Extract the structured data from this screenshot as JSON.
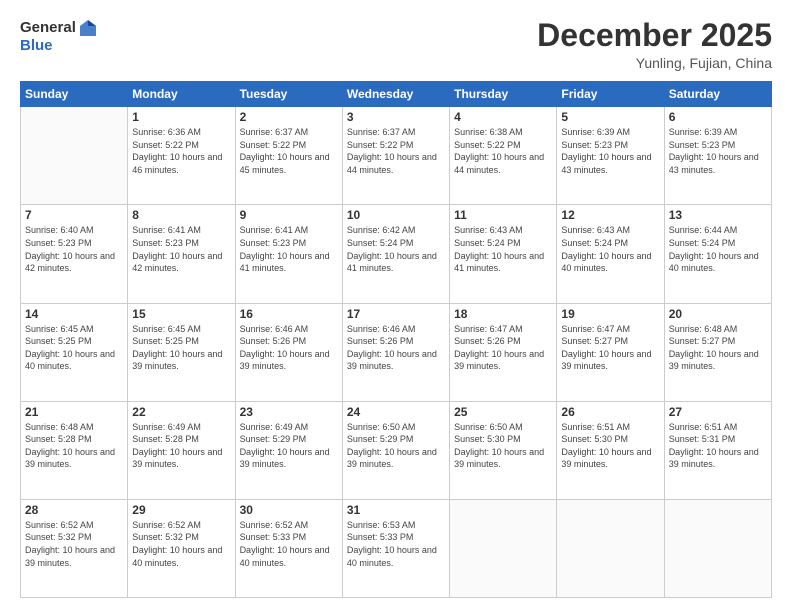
{
  "header": {
    "logo_general": "General",
    "logo_blue": "Blue",
    "month_title": "December 2025",
    "location": "Yunling, Fujian, China"
  },
  "weekdays": [
    "Sunday",
    "Monday",
    "Tuesday",
    "Wednesday",
    "Thursday",
    "Friday",
    "Saturday"
  ],
  "weeks": [
    [
      {
        "day": "",
        "sunrise": "",
        "sunset": "",
        "daylight": ""
      },
      {
        "day": "1",
        "sunrise": "Sunrise: 6:36 AM",
        "sunset": "Sunset: 5:22 PM",
        "daylight": "Daylight: 10 hours and 46 minutes."
      },
      {
        "day": "2",
        "sunrise": "Sunrise: 6:37 AM",
        "sunset": "Sunset: 5:22 PM",
        "daylight": "Daylight: 10 hours and 45 minutes."
      },
      {
        "day": "3",
        "sunrise": "Sunrise: 6:37 AM",
        "sunset": "Sunset: 5:22 PM",
        "daylight": "Daylight: 10 hours and 44 minutes."
      },
      {
        "day": "4",
        "sunrise": "Sunrise: 6:38 AM",
        "sunset": "Sunset: 5:22 PM",
        "daylight": "Daylight: 10 hours and 44 minutes."
      },
      {
        "day": "5",
        "sunrise": "Sunrise: 6:39 AM",
        "sunset": "Sunset: 5:23 PM",
        "daylight": "Daylight: 10 hours and 43 minutes."
      },
      {
        "day": "6",
        "sunrise": "Sunrise: 6:39 AM",
        "sunset": "Sunset: 5:23 PM",
        "daylight": "Daylight: 10 hours and 43 minutes."
      }
    ],
    [
      {
        "day": "7",
        "sunrise": "Sunrise: 6:40 AM",
        "sunset": "Sunset: 5:23 PM",
        "daylight": "Daylight: 10 hours and 42 minutes."
      },
      {
        "day": "8",
        "sunrise": "Sunrise: 6:41 AM",
        "sunset": "Sunset: 5:23 PM",
        "daylight": "Daylight: 10 hours and 42 minutes."
      },
      {
        "day": "9",
        "sunrise": "Sunrise: 6:41 AM",
        "sunset": "Sunset: 5:23 PM",
        "daylight": "Daylight: 10 hours and 41 minutes."
      },
      {
        "day": "10",
        "sunrise": "Sunrise: 6:42 AM",
        "sunset": "Sunset: 5:24 PM",
        "daylight": "Daylight: 10 hours and 41 minutes."
      },
      {
        "day": "11",
        "sunrise": "Sunrise: 6:43 AM",
        "sunset": "Sunset: 5:24 PM",
        "daylight": "Daylight: 10 hours and 41 minutes."
      },
      {
        "day": "12",
        "sunrise": "Sunrise: 6:43 AM",
        "sunset": "Sunset: 5:24 PM",
        "daylight": "Daylight: 10 hours and 40 minutes."
      },
      {
        "day": "13",
        "sunrise": "Sunrise: 6:44 AM",
        "sunset": "Sunset: 5:24 PM",
        "daylight": "Daylight: 10 hours and 40 minutes."
      }
    ],
    [
      {
        "day": "14",
        "sunrise": "Sunrise: 6:45 AM",
        "sunset": "Sunset: 5:25 PM",
        "daylight": "Daylight: 10 hours and 40 minutes."
      },
      {
        "day": "15",
        "sunrise": "Sunrise: 6:45 AM",
        "sunset": "Sunset: 5:25 PM",
        "daylight": "Daylight: 10 hours and 39 minutes."
      },
      {
        "day": "16",
        "sunrise": "Sunrise: 6:46 AM",
        "sunset": "Sunset: 5:26 PM",
        "daylight": "Daylight: 10 hours and 39 minutes."
      },
      {
        "day": "17",
        "sunrise": "Sunrise: 6:46 AM",
        "sunset": "Sunset: 5:26 PM",
        "daylight": "Daylight: 10 hours and 39 minutes."
      },
      {
        "day": "18",
        "sunrise": "Sunrise: 6:47 AM",
        "sunset": "Sunset: 5:26 PM",
        "daylight": "Daylight: 10 hours and 39 minutes."
      },
      {
        "day": "19",
        "sunrise": "Sunrise: 6:47 AM",
        "sunset": "Sunset: 5:27 PM",
        "daylight": "Daylight: 10 hours and 39 minutes."
      },
      {
        "day": "20",
        "sunrise": "Sunrise: 6:48 AM",
        "sunset": "Sunset: 5:27 PM",
        "daylight": "Daylight: 10 hours and 39 minutes."
      }
    ],
    [
      {
        "day": "21",
        "sunrise": "Sunrise: 6:48 AM",
        "sunset": "Sunset: 5:28 PM",
        "daylight": "Daylight: 10 hours and 39 minutes."
      },
      {
        "day": "22",
        "sunrise": "Sunrise: 6:49 AM",
        "sunset": "Sunset: 5:28 PM",
        "daylight": "Daylight: 10 hours and 39 minutes."
      },
      {
        "day": "23",
        "sunrise": "Sunrise: 6:49 AM",
        "sunset": "Sunset: 5:29 PM",
        "daylight": "Daylight: 10 hours and 39 minutes."
      },
      {
        "day": "24",
        "sunrise": "Sunrise: 6:50 AM",
        "sunset": "Sunset: 5:29 PM",
        "daylight": "Daylight: 10 hours and 39 minutes."
      },
      {
        "day": "25",
        "sunrise": "Sunrise: 6:50 AM",
        "sunset": "Sunset: 5:30 PM",
        "daylight": "Daylight: 10 hours and 39 minutes."
      },
      {
        "day": "26",
        "sunrise": "Sunrise: 6:51 AM",
        "sunset": "Sunset: 5:30 PM",
        "daylight": "Daylight: 10 hours and 39 minutes."
      },
      {
        "day": "27",
        "sunrise": "Sunrise: 6:51 AM",
        "sunset": "Sunset: 5:31 PM",
        "daylight": "Daylight: 10 hours and 39 minutes."
      }
    ],
    [
      {
        "day": "28",
        "sunrise": "Sunrise: 6:52 AM",
        "sunset": "Sunset: 5:32 PM",
        "daylight": "Daylight: 10 hours and 39 minutes."
      },
      {
        "day": "29",
        "sunrise": "Sunrise: 6:52 AM",
        "sunset": "Sunset: 5:32 PM",
        "daylight": "Daylight: 10 hours and 40 minutes."
      },
      {
        "day": "30",
        "sunrise": "Sunrise: 6:52 AM",
        "sunset": "Sunset: 5:33 PM",
        "daylight": "Daylight: 10 hours and 40 minutes."
      },
      {
        "day": "31",
        "sunrise": "Sunrise: 6:53 AM",
        "sunset": "Sunset: 5:33 PM",
        "daylight": "Daylight: 10 hours and 40 minutes."
      },
      {
        "day": "",
        "sunrise": "",
        "sunset": "",
        "daylight": ""
      },
      {
        "day": "",
        "sunrise": "",
        "sunset": "",
        "daylight": ""
      },
      {
        "day": "",
        "sunrise": "",
        "sunset": "",
        "daylight": ""
      }
    ]
  ]
}
